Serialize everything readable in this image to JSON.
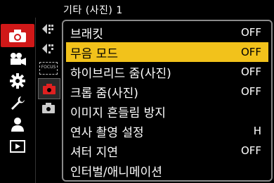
{
  "header": {
    "title": "기타 (사진) 1"
  },
  "main_tabs": [
    {
      "icon": "camera-icon",
      "active": true
    },
    {
      "icon": "movie-camera-icon",
      "active": false
    },
    {
      "icon": "gear-icon",
      "active": false
    },
    {
      "icon": "wrench-icon",
      "active": false
    },
    {
      "icon": "person-icon",
      "active": false
    },
    {
      "icon": "playback-icon",
      "active": false
    }
  ],
  "sub_tabs": [
    {
      "icon": "photo-quality-icon",
      "label": ""
    },
    {
      "icon": "photo-quality-alt-icon",
      "label": ""
    },
    {
      "icon": "focus-icon",
      "label": "FOCUS"
    },
    {
      "icon": "red-camera-icon",
      "label": ""
    },
    {
      "icon": "camera-alt-icon",
      "label": ""
    }
  ],
  "menu": {
    "items": [
      {
        "label": "브래킷",
        "value": "OFF"
      },
      {
        "label": "무음 모드",
        "value": "OFF",
        "selected": true
      },
      {
        "label": "하이브리드 줌(사진)",
        "value": "OFF"
      },
      {
        "label": "크롭 줌(사진)",
        "value": "OFF"
      },
      {
        "label": "이미지 흔들림 방지",
        "value": ""
      },
      {
        "label": "연사 촬영 설정",
        "value": "H"
      },
      {
        "label": "셔터 지연",
        "value": "OFF"
      },
      {
        "label": "인터벌/애니메이션",
        "value": ""
      }
    ]
  },
  "colors": {
    "accent": "#d01818",
    "highlight": "#f2c21b",
    "border": "#8a8a8a"
  }
}
